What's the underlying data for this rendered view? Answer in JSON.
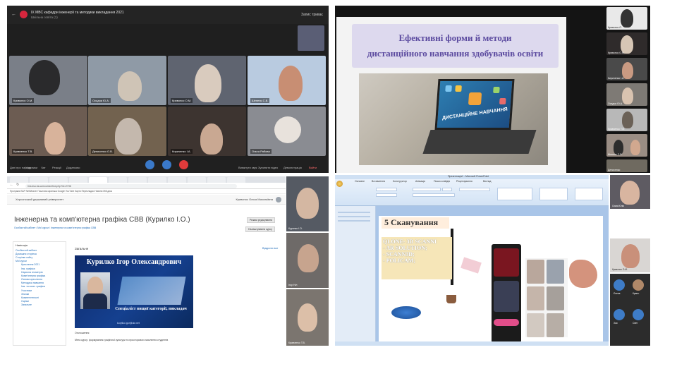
{
  "conference": {
    "title": "ІХ МВС кафедри інженерії та методики викладання 2021",
    "subtitle": "Шкільна освіта (1)",
    "recording": "Запис триває",
    "participants": [
      {
        "name": "Кривонос О.М.",
        "bg": "#7a7f88"
      },
      {
        "name": "Осадча Ю.А.",
        "bg": "#8f9aa6"
      },
      {
        "name": "Кривонос О.М.",
        "bg": "#5f6470"
      },
      {
        "name": "Шепель С.В.",
        "bg": "#b9cbe0"
      },
      {
        "name": "Кравченко Т.В.",
        "bg": "#6c5c52"
      },
      {
        "name": "Денисенко О.В.",
        "bg": "#72624f"
      },
      {
        "name": "Кириченко І.А.",
        "bg": "#3d3430"
      },
      {
        "name": "Ольга Рябова",
        "bg": "#8a8c92"
      }
    ],
    "controls": [
      {
        "label": "Дані про нараду"
      },
      {
        "label": "Учасники"
      },
      {
        "label": "Чат"
      },
      {
        "label": "Реакції"
      },
      {
        "label": "Додатково"
      },
      {
        "label": "Вимкнути звук"
      },
      {
        "label": "Зупинити відео"
      },
      {
        "label": "Демонстрація"
      },
      {
        "label": "Вийти"
      }
    ]
  },
  "presentation": {
    "slide_title_line1": "Ефективні форми й методи",
    "slide_title_line2": "дистанційного навчання здобувачів освіти",
    "laptop_label": "ДИСТАНЦІЙНЕ НАВЧАННЯ",
    "thumbnails": [
      {
        "name": "Кривонос О.",
        "bg": "#e9e9e9"
      },
      {
        "name": "Кривонос О.М.",
        "bg": "#2f2b2b"
      },
      {
        "name": "Кириченко І.А.",
        "bg": "#4a4a4a"
      },
      {
        "name": "Осадча Ю.А.",
        "bg": "#7e7a75"
      },
      {
        "name": "Кравченко Т.В.",
        "bg": "#b8b8b8"
      },
      {
        "name": "Шепель С.В.",
        "bg": "#9a8d84"
      },
      {
        "name": "Денисенко",
        "bg": "#6f6a60"
      }
    ]
  },
  "browser": {
    "url": "lms.ksu.ks.ua/course/view.php?id=2736",
    "bookmarks": "Програми   SAP NetWeaver   Поштова скринька   Google   YouTube   Карти   Перекладач   Новини   Мій диск",
    "site_name": "Херсонський державний університет",
    "user_name": "Кривонос Ольга Миколаївна",
    "course_title": "Інженерна та комп'ютерна графіка СВВ (Курилко І.О.)",
    "breadcrumbs": "Особистий кабінет  /  Мої курси  /  Інженерна та комп'ютерна графіка СВВ",
    "settings_button": "Режим редагування",
    "tools_button": "Налаштування курсу",
    "nav_header": "Навігація",
    "nav_items": [
      {
        "label": "Особистий кабінет",
        "sub": false
      },
      {
        "label": "Домашня сторінка",
        "sub": false
      },
      {
        "label": "Сторінки сайту",
        "sub": false
      },
      {
        "label": "Мої курси",
        "sub": false
      },
      {
        "label": "Креслення 2021",
        "sub": true
      },
      {
        "label": "Інж. графіка",
        "sub": true
      },
      {
        "label": "Нарисна геометрія",
        "sub": true
      },
      {
        "label": "Комп'ютерна графіка",
        "sub": true
      },
      {
        "label": "Основи креслення",
        "sub": true
      },
      {
        "label": "Методика навчання",
        "sub": true
      },
      {
        "label": "Інж. та комп. графіка",
        "sub": true
      },
      {
        "label": "Учасники",
        "sub": true
      },
      {
        "label": "Значки",
        "sub": true
      },
      {
        "label": "Компетентності",
        "sub": true
      },
      {
        "label": "Оцінки",
        "sub": true
      },
      {
        "label": "Загальне",
        "sub": true
      }
    ],
    "section_header": "Загальне",
    "section_link": "Відкрити все",
    "teacher_name": "Курилко Ігор Олександрович",
    "teacher_role": "Спеціаліст вищої категорії, викладач",
    "teacher_email": "kurylko.igor@ukr.net",
    "section_label": "Оголошення",
    "description": "Мета курсу: формування графічної культури та просторового мислення студентів"
  },
  "side_videos": [
    {
      "name": "Курилко І.О.",
      "bg": "#555a63"
    },
    {
      "name": "Ігор Ніл",
      "bg": "#6e6a68"
    },
    {
      "name": "Кравченко Т.В.",
      "bg": "#7b756f"
    }
  ],
  "ppt": {
    "window_title": "Презентація1 - Microsoft PowerPoint",
    "ribbon_tabs": [
      "Основне",
      "Вставлення",
      "Конструктор",
      "Анімація",
      "Показ слайдів",
      "Рецензування",
      "Вигляд"
    ],
    "slide_title": "5 Сканування",
    "bullets": [
      "QLONE- 3D SCANNI",
      "- AR SOLUTION;",
      "- SCANN3D;",
      "- POLICAM;"
    ],
    "participant_views": [
      {
        "name": "Сюма Юлія",
        "bg": "#5e5b62"
      },
      {
        "name": "Кривонос О.М.",
        "bg": "#d9d6d3"
      }
    ],
    "avatars": [
      {
        "name": "Єлена"
      },
      {
        "name": "Кравч."
      },
      {
        "name": "Зоя"
      },
      {
        "name": "Олег"
      }
    ]
  }
}
